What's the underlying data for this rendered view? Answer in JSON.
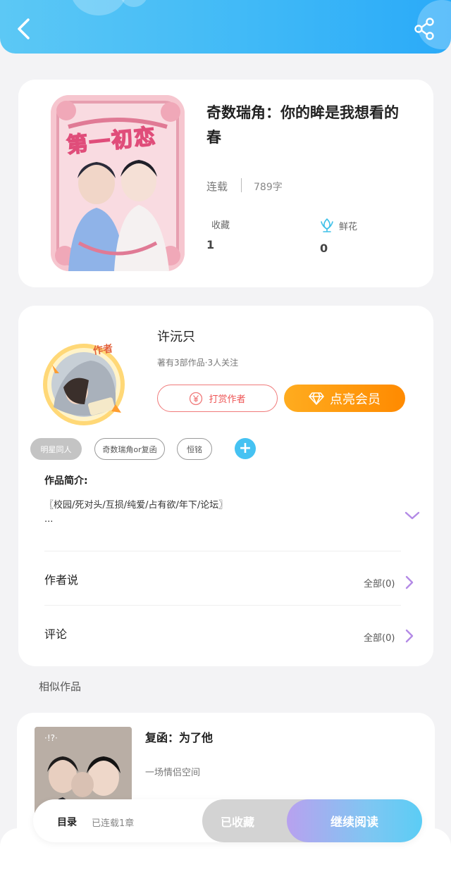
{
  "header": {
    "back_icon": "chevron-left-icon",
    "share_icon": "share-icon",
    "gradient": [
      "#5cc8f5",
      "#2aaaf8"
    ]
  },
  "book": {
    "cover_text": "第一初恋",
    "title": "奇数瑞角：你的眸是我想看的春",
    "status": "连载",
    "word_count": "789字",
    "favorites_label": "收藏",
    "favorites_count": "1",
    "flowers_label": "鲜花",
    "flowers_count": "0"
  },
  "author": {
    "badge": "作者",
    "name": "许沅只",
    "meta": "著有3部作品·3人关注",
    "tip_label": "打赏作者",
    "vip_label": "点亮会员"
  },
  "tags": [
    "明星同人",
    "奇数瑞角or复函",
    "恒铭"
  ],
  "intro": {
    "label": "作品简介:",
    "text": "〖校园/死对头/互损/纯爱/占有欲/年下/论坛〗",
    "ellipsis": "..."
  },
  "rows": [
    {
      "title": "作者说",
      "right": "全部(0)"
    },
    {
      "title": "评论",
      "right": "全部(0)"
    }
  ],
  "similar": {
    "heading": "相似作品",
    "items": [
      {
        "title": "复函：为了他",
        "desc": "一场情侣空间"
      }
    ]
  },
  "bottom_bar": {
    "toc_label": "目录",
    "toc_status": "已连载1章",
    "collected_label": "已收藏",
    "read_label": "继续阅读"
  },
  "colors": {
    "accent_blue": "#45c2f2",
    "vip_orange": "#ff8a00",
    "tip_red": "#f07a7a",
    "chevron_purple": "#b38ae6"
  }
}
